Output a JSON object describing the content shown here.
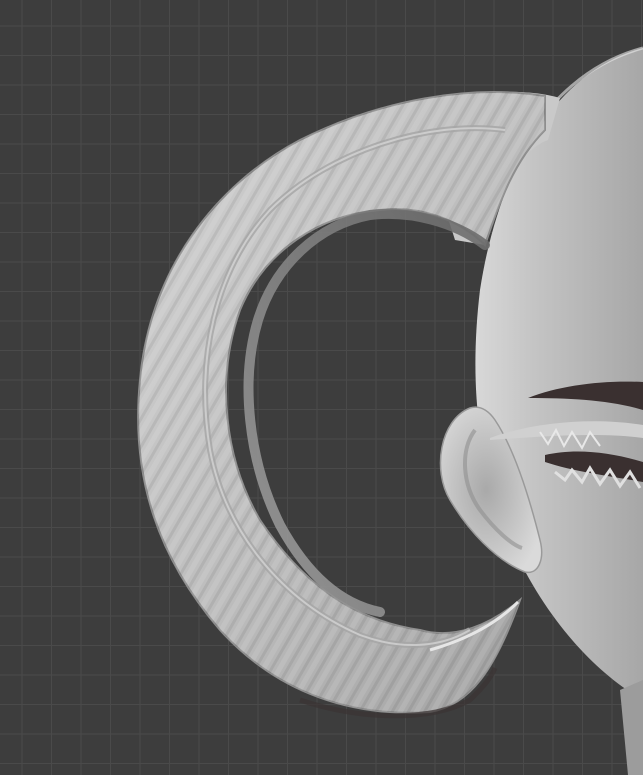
{
  "viewport": {
    "background_color": "#3d3d3d",
    "grid_color": "#4a4a4a"
  },
  "model": {
    "material_color": "#b9b9b9",
    "shadow_color": "#2a2a2a",
    "parts": [
      "head",
      "ear",
      "horn",
      "brow",
      "eyelash-fringe"
    ]
  }
}
